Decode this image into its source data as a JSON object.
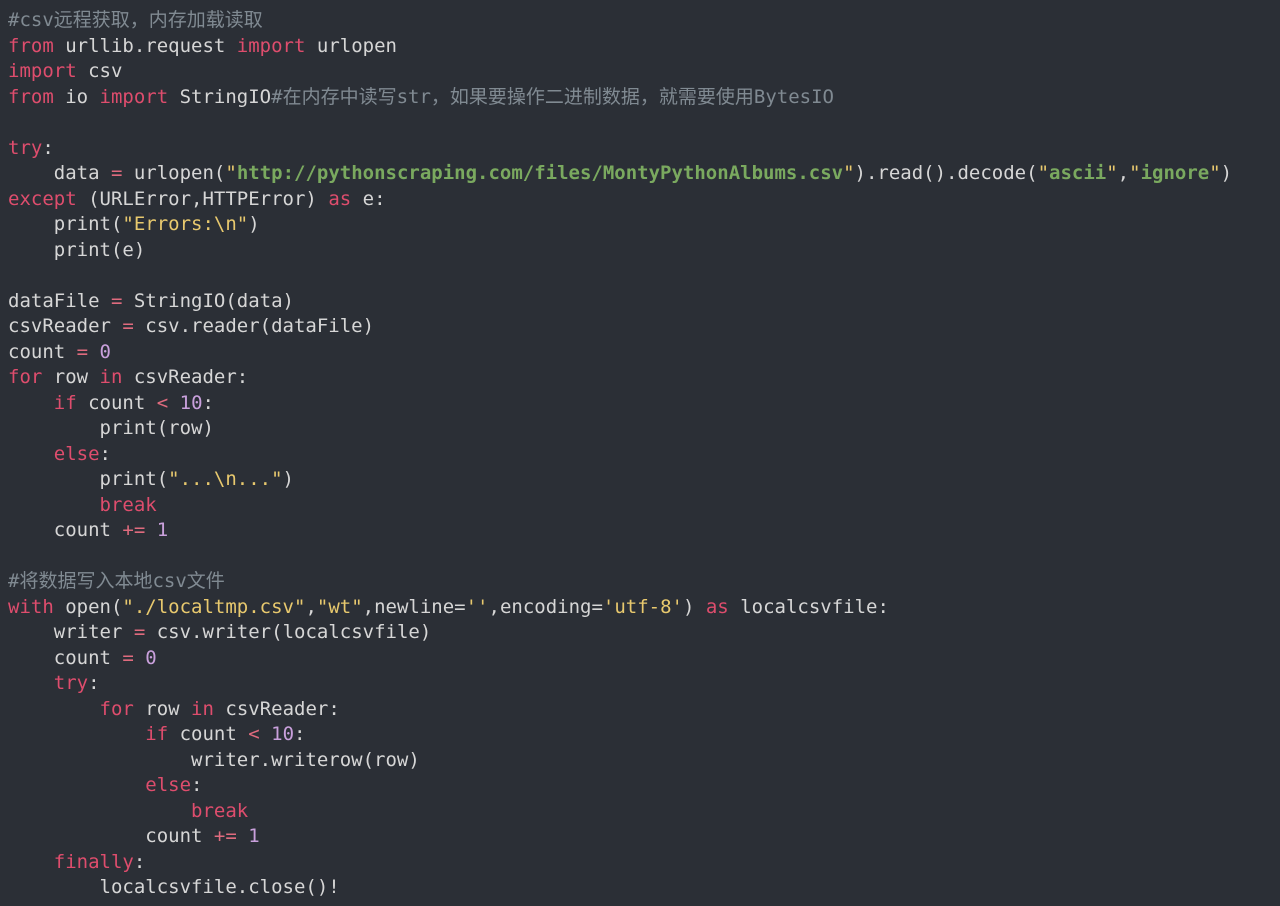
{
  "code": {
    "c1": "#csv远程获取，内存加载读取",
    "l2a": "from",
    "l2b": " urllib.request ",
    "l2c": "import",
    "l2d": " urlopen",
    "l3a": "import",
    "l3b": " csv",
    "l4a": "from",
    "l4b": " io ",
    "l4c": "import",
    "l4d": " StringIO",
    "l4e": "#在内存中读写str，如果要操作二进制数据，就需要使用BytesIO",
    "l5": "",
    "l6a": "try",
    "l6b": ":",
    "l7a": "    data ",
    "l7b": "=",
    "l7c": " urlopen(",
    "l7d": "\"",
    "l7e": "http://pythonscraping.com/files/MontyPythonAlbums.csv",
    "l7f": "\"",
    "l7g": ").read().decode(",
    "l7h": "\"",
    "l7i": "ascii",
    "l7j": "\"",
    "l7k": ",",
    "l7l": "\"",
    "l7m": "ignore",
    "l7n": "\"",
    "l7o": ")",
    "l8a": "except",
    "l8b": " (URLError,HTTPError) ",
    "l8c": "as",
    "l8d": " e:",
    "l9a": "    print(",
    "l9b": "\"Errors:\\n\"",
    "l9c": ")",
    "l10a": "    print(e)",
    "l11": "",
    "l12a": "dataFile ",
    "l12b": "=",
    "l12c": " StringIO(data)",
    "l13a": "csvReader ",
    "l13b": "=",
    "l13c": " csv.reader(dataFile)",
    "l14a": "count ",
    "l14b": "=",
    "l14c": " ",
    "l14d": "0",
    "l15a": "for",
    "l15b": " row ",
    "l15c": "in",
    "l15d": " csvReader:",
    "l16a": "    ",
    "l16b": "if",
    "l16c": " count ",
    "l16d": "<",
    "l16e": " ",
    "l16f": "10",
    "l16g": ":",
    "l17a": "        print(row)",
    "l18a": "    ",
    "l18b": "else",
    "l18c": ":",
    "l19a": "        print(",
    "l19b": "\"...\\n...\"",
    "l19c": ")",
    "l20a": "        ",
    "l20b": "break",
    "l21a": "    count ",
    "l21b": "+=",
    "l21c": " ",
    "l21d": "1",
    "l22": "",
    "c2": "#将数据写入本地csv文件",
    "l24a": "with",
    "l24b": " open(",
    "l24c": "\"./localtmp.csv\"",
    "l24d": ",",
    "l24e": "\"wt\"",
    "l24f": ",newline=",
    "l24g": "''",
    "l24h": ",encoding=",
    "l24i": "'utf-8'",
    "l24j": ") ",
    "l24k": "as",
    "l24l": " localcsvfile:",
    "l25a": "    writer ",
    "l25b": "=",
    "l25c": " csv.writer(localcsvfile)",
    "l26a": "    count ",
    "l26b": "=",
    "l26c": " ",
    "l26d": "0",
    "l27a": "    ",
    "l27b": "try",
    "l27c": ":",
    "l28a": "        ",
    "l28b": "for",
    "l28c": " row ",
    "l28d": "in",
    "l28e": " csvReader:",
    "l29a": "            ",
    "l29b": "if",
    "l29c": " count ",
    "l29d": "<",
    "l29e": " ",
    "l29f": "10",
    "l29g": ":",
    "l30a": "                writer.writerow(row)",
    "l31a": "            ",
    "l31b": "else",
    "l31c": ":",
    "l32a": "                ",
    "l32b": "break",
    "l33a": "            count ",
    "l33b": "+=",
    "l33c": " ",
    "l33d": "1",
    "l34a": "    ",
    "l34b": "finally",
    "l34c": ":",
    "l35a": "        localcsvfile.close()!"
  }
}
